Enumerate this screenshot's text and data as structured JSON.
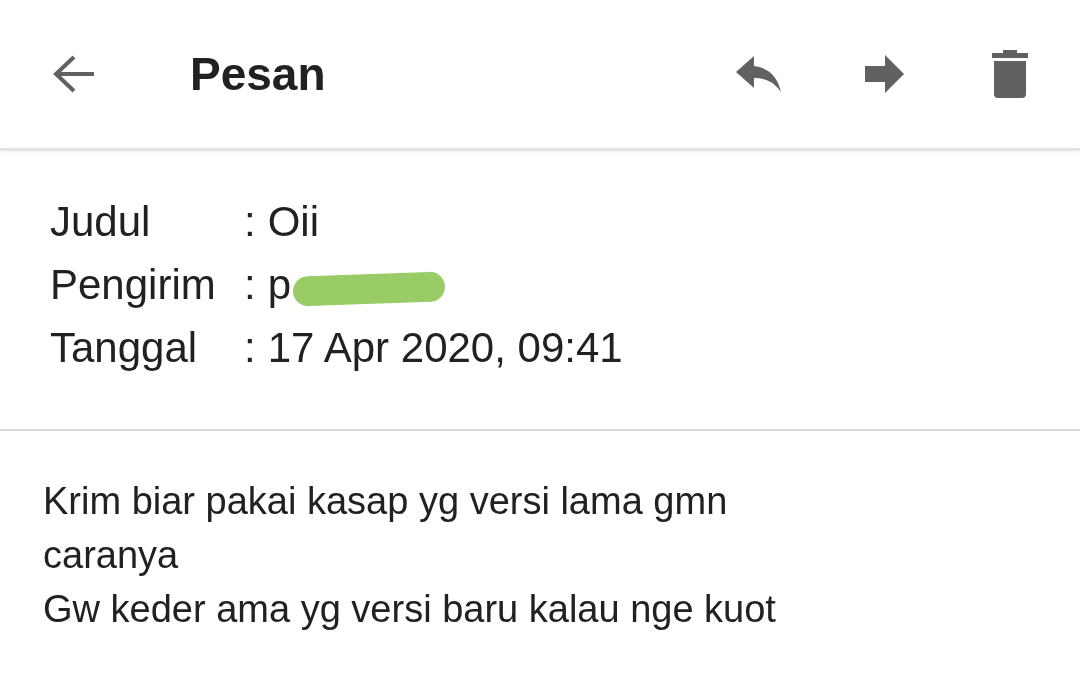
{
  "app_bar": {
    "title": "Pesan"
  },
  "fields": [
    {
      "label": "Judul",
      "separator": ":",
      "value": "Oii",
      "redacted": false
    },
    {
      "label": "Pengirim",
      "separator": ":",
      "value": "p",
      "redacted": true
    },
    {
      "label": "Tanggal",
      "separator": ":",
      "value": "17 Apr 2020, 09:41",
      "redacted": false
    }
  ],
  "body": [
    "Krim biar pakai kasap yg versi lama gmn caranya",
    "Gw keder ama yg versi baru kalau nge kuot"
  ]
}
